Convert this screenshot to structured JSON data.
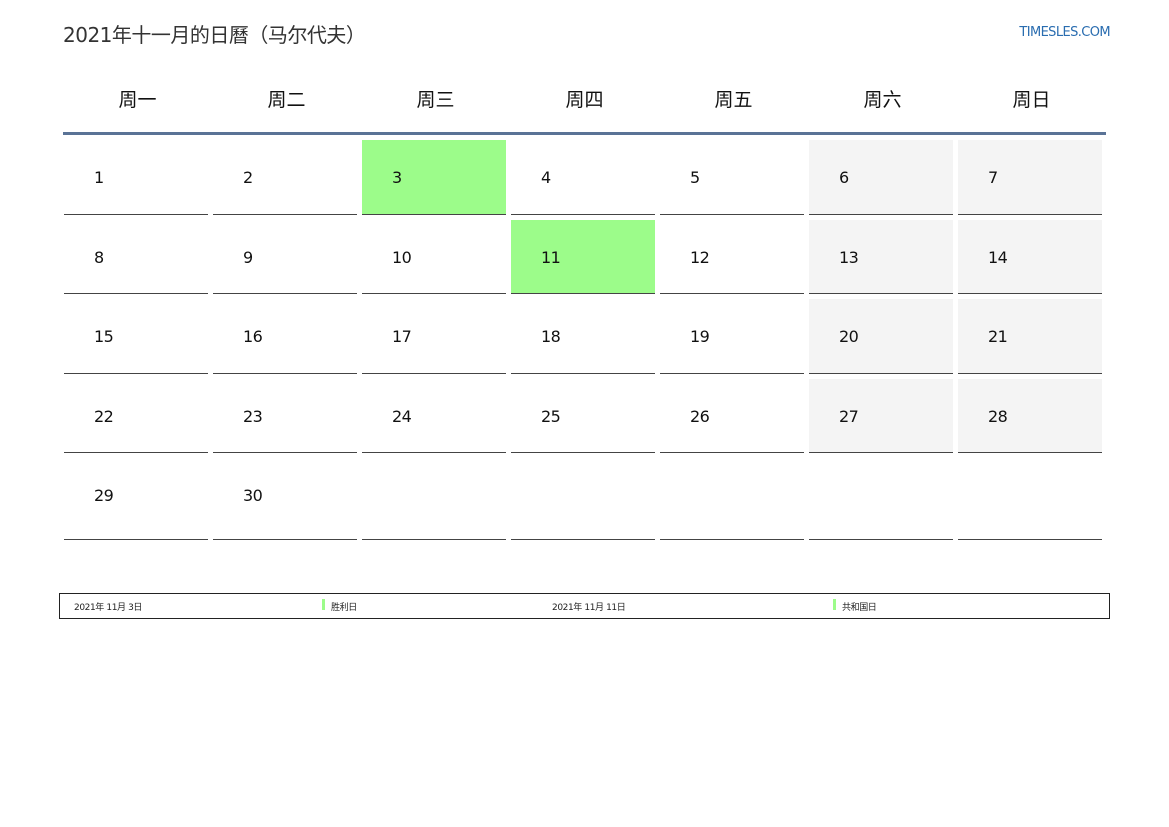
{
  "header": {
    "title": "2021年十一月的日曆（马尔代夫）",
    "site": "TIMESLES.COM"
  },
  "weekdays": [
    "周一",
    "周二",
    "周三",
    "周四",
    "周五",
    "周六",
    "周日"
  ],
  "weeks": [
    [
      {
        "day": "1"
      },
      {
        "day": "2"
      },
      {
        "day": "3",
        "holiday": true
      },
      {
        "day": "4"
      },
      {
        "day": "5"
      },
      {
        "day": "6",
        "weekend": true
      },
      {
        "day": "7",
        "weekend": true
      }
    ],
    [
      {
        "day": "8"
      },
      {
        "day": "9"
      },
      {
        "day": "10"
      },
      {
        "day": "11",
        "holiday": true
      },
      {
        "day": "12"
      },
      {
        "day": "13",
        "weekend": true
      },
      {
        "day": "14",
        "weekend": true
      }
    ],
    [
      {
        "day": "15"
      },
      {
        "day": "16"
      },
      {
        "day": "17"
      },
      {
        "day": "18"
      },
      {
        "day": "19"
      },
      {
        "day": "20",
        "weekend": true
      },
      {
        "day": "21",
        "weekend": true
      }
    ],
    [
      {
        "day": "22"
      },
      {
        "day": "23"
      },
      {
        "day": "24"
      },
      {
        "day": "25"
      },
      {
        "day": "26"
      },
      {
        "day": "27",
        "weekend": true
      },
      {
        "day": "28",
        "weekend": true
      }
    ],
    [
      {
        "day": "29"
      },
      {
        "day": "30"
      },
      {
        "day": ""
      },
      {
        "day": ""
      },
      {
        "day": ""
      },
      {
        "day": ""
      },
      {
        "day": ""
      }
    ]
  ],
  "legend": [
    {
      "date": "2021年 11月 3日",
      "name": "胜利日"
    },
    {
      "date": "2021年 11月 11日",
      "name": "共和国日"
    }
  ],
  "colors": {
    "holiday": "#9cfc8a",
    "weekend": "#f4f4f4",
    "header_rule": "#5a7396",
    "link": "#2a6db0"
  }
}
